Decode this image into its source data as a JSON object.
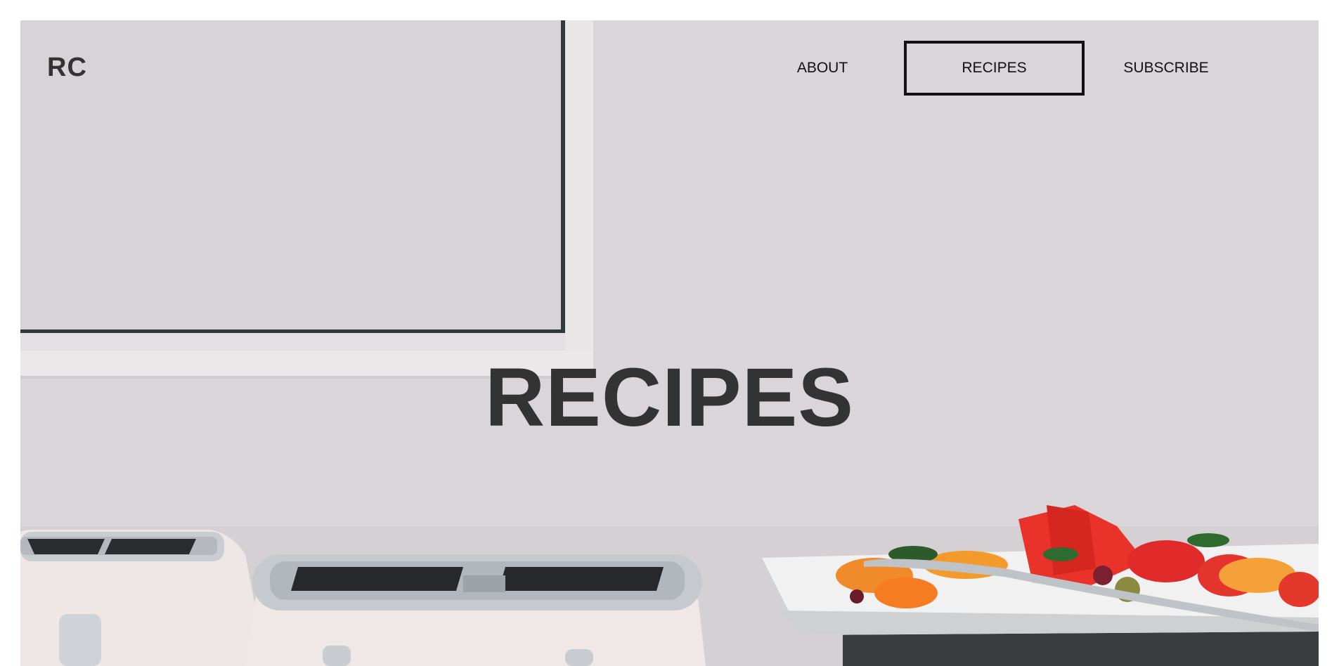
{
  "brand": {
    "logo": "RC"
  },
  "nav": {
    "items": [
      {
        "label": "ABOUT"
      },
      {
        "label": "RECIPES",
        "active": true
      },
      {
        "label": "SUBSCRIBE"
      }
    ]
  },
  "hero": {
    "title": "RECIPES",
    "image": {
      "depicts": [
        "white-cabinet",
        "white-toaster",
        "white-toaster",
        "fruit-platter",
        "serving-tongs"
      ]
    }
  },
  "colors": {
    "background": "#d9d4d7",
    "text": "#333333",
    "nav_text": "#111111",
    "active_border": "#111111",
    "page": "#ffffff"
  }
}
